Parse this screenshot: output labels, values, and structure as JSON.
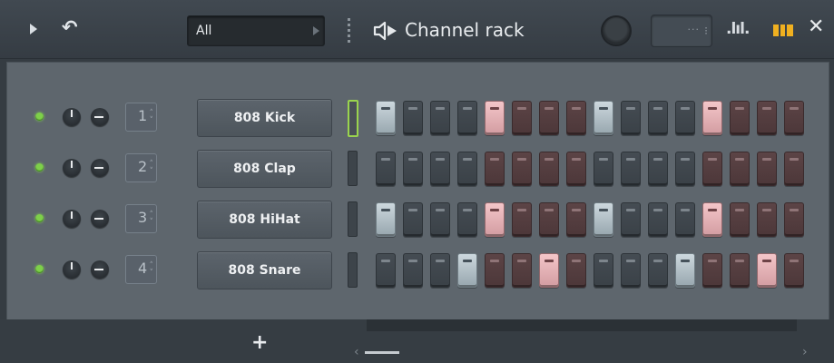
{
  "titlebar": {
    "filter_value": "All",
    "title": "Channel rack",
    "pattern_dots": "···",
    "icons": [
      "play-icon",
      "undo-icon",
      "grip-icon",
      "speaker-icon",
      "swing-knob",
      "graph-icon",
      "piano-roll-icon",
      "close-icon"
    ]
  },
  "channels": [
    {
      "number": "1",
      "name": "808 Kick",
      "selected": true,
      "steps": [
        "gw",
        "g",
        "g",
        "g",
        "rw",
        "r",
        "r",
        "r",
        "gw",
        "g",
        "g",
        "g",
        "rw",
        "r",
        "r",
        "r"
      ]
    },
    {
      "number": "2",
      "name": "808 Clap",
      "selected": false,
      "steps": [
        "g",
        "g",
        "g",
        "g",
        "r",
        "r",
        "r",
        "r",
        "g",
        "g",
        "g",
        "g",
        "r",
        "r",
        "r",
        "r"
      ]
    },
    {
      "number": "3",
      "name": "808 HiHat",
      "selected": false,
      "steps": [
        "gw",
        "g",
        "g",
        "g",
        "rw",
        "r",
        "r",
        "r",
        "gw",
        "g",
        "g",
        "g",
        "rw",
        "r",
        "r",
        "r"
      ]
    },
    {
      "number": "4",
      "name": "808 Snare",
      "selected": false,
      "steps": [
        "g",
        "g",
        "g",
        "gw",
        "r",
        "r",
        "rw",
        "r",
        "g",
        "g",
        "g",
        "gw",
        "r",
        "r",
        "rw",
        "r"
      ]
    }
  ],
  "bottom": {
    "add_label": "+",
    "scroll_left": "‹",
    "scroll_right": "›"
  },
  "colors": {
    "led_green": "#7ed04a",
    "selection_green": "#9ad44e",
    "step_on_gray": "#cdd8de",
    "step_on_pink": "#f4c6c9"
  }
}
